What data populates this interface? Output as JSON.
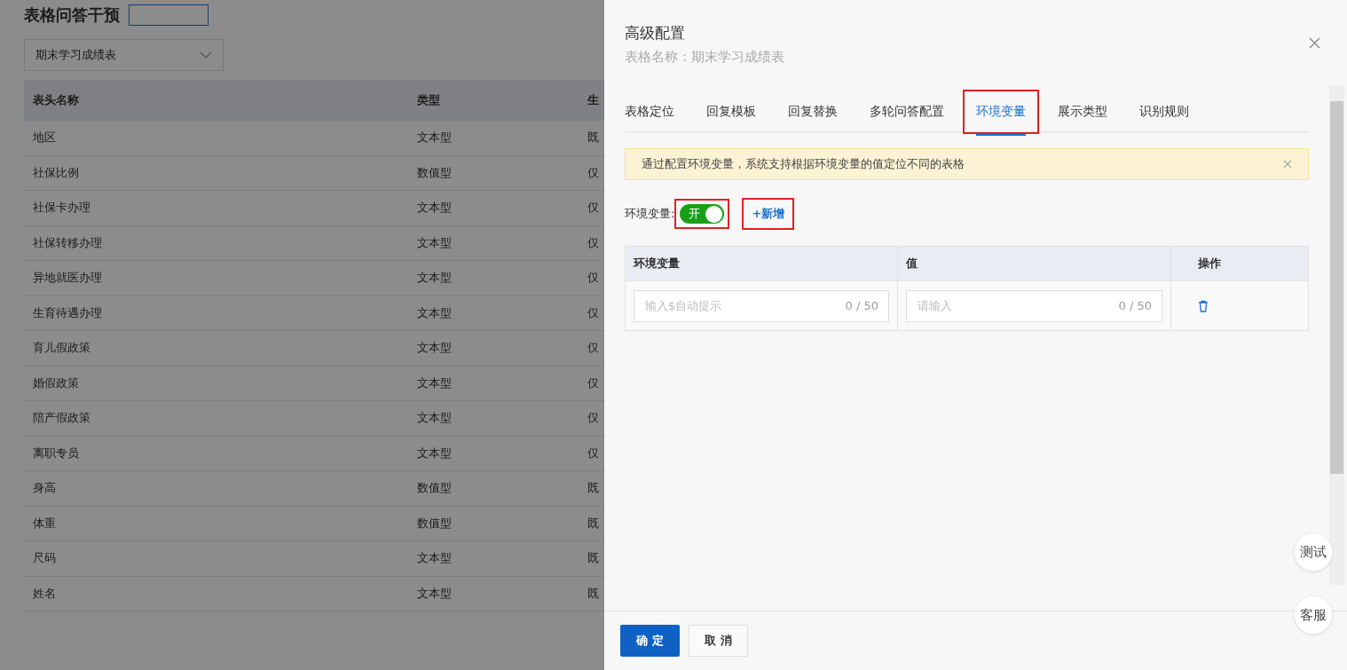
{
  "page": {
    "title": "表格问答干预",
    "table_select": {
      "value": "期末学习成绩表"
    },
    "table": {
      "columns": [
        "表头名称",
        "类型",
        "生"
      ],
      "rows": [
        [
          "地区",
          "文本型",
          "既"
        ],
        [
          "社保比例",
          "数值型",
          "仅"
        ],
        [
          "社保卡办理",
          "文本型",
          "仅"
        ],
        [
          "社保转移办理",
          "文本型",
          "仅"
        ],
        [
          "异地就医办理",
          "文本型",
          "仅"
        ],
        [
          "生育待遇办理",
          "文本型",
          "仅"
        ],
        [
          "育儿假政策",
          "文本型",
          "仅"
        ],
        [
          "婚假政策",
          "文本型",
          "仅"
        ],
        [
          "陪产假政策",
          "文本型",
          "仅"
        ],
        [
          "离职专员",
          "文本型",
          "仅"
        ],
        [
          "身高",
          "数值型",
          "既"
        ],
        [
          "体重",
          "数值型",
          "既"
        ],
        [
          "尺码",
          "文本型",
          "既"
        ],
        [
          "姓名",
          "文本型",
          "既"
        ]
      ]
    }
  },
  "drawer": {
    "title": "高级配置",
    "subtitle": "表格名称：期末学习成绩表",
    "tabs": [
      {
        "label": "表格定位",
        "selected": false,
        "highlighted": false
      },
      {
        "label": "回复模板",
        "selected": false,
        "highlighted": false
      },
      {
        "label": "回复替换",
        "selected": false,
        "highlighted": false
      },
      {
        "label": "多轮问答配置",
        "selected": false,
        "highlighted": false
      },
      {
        "label": "环境变量",
        "selected": true,
        "highlighted": true
      },
      {
        "label": "展示类型",
        "selected": false,
        "highlighted": false
      },
      {
        "label": "识别规则",
        "selected": false,
        "highlighted": false
      }
    ],
    "alert": "通过配置环境变量，系统支持根据环境变量的值定位不同的表格",
    "switch": {
      "label": "环境变量:",
      "text": "开",
      "on": true,
      "highlighted": true
    },
    "add_link": {
      "label": "+新增",
      "highlighted": true
    },
    "var_table": {
      "columns": [
        "环境变量",
        "值",
        "操作"
      ],
      "rows": [
        {
          "name_placeholder": "输入$自动提示",
          "name_count": "0 / 50",
          "value_placeholder": "请输入",
          "value_count": "0 / 50"
        }
      ]
    },
    "buttons": {
      "confirm": "确 定",
      "cancel": "取 消"
    }
  },
  "floating": [
    "测试",
    "客服"
  ]
}
